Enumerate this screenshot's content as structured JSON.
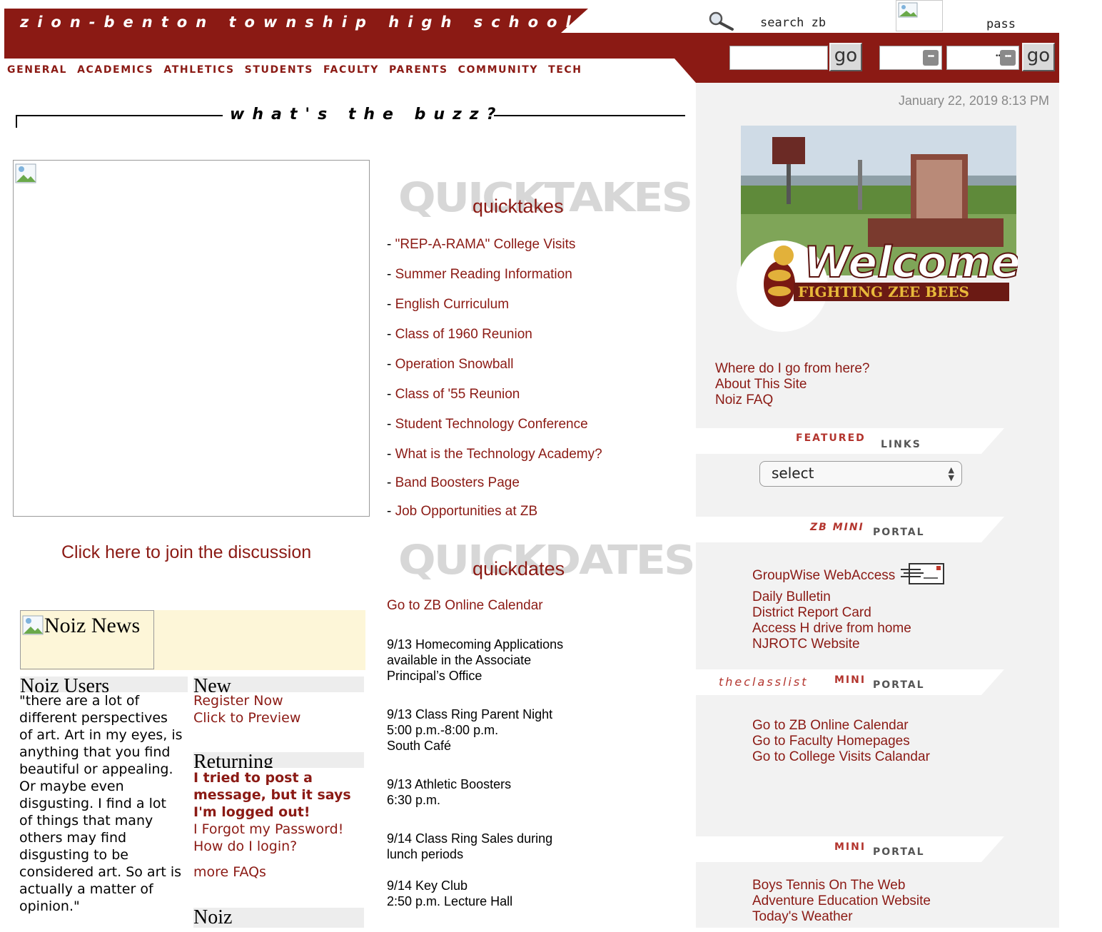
{
  "header": {
    "site_title": "zion-benton township high school",
    "search_label": "search zb",
    "pass_label": "pass",
    "go_label": "go",
    "nav": [
      "GENERAL",
      "ACADEMICS",
      "ATHLETICS",
      "STUDENTS",
      "FACULTY",
      "PARENTS",
      "COMMUNITY",
      "TECH"
    ]
  },
  "buzz": {
    "title": "what's the buzz?",
    "discussion_link": "Click here to join the discussion"
  },
  "quicktakes": {
    "big": "QUICKTAKES",
    "label": "quicktakes",
    "items": [
      "\"REP-A-RAMA\" College Visits",
      "Summer Reading Information",
      "English Curriculum",
      "Class of 1960 Reunion",
      "Operation Snowball",
      "Class of '55 Reunion",
      "Student Technology Conference",
      "What is the Technology Academy?",
      "Band Boosters Page",
      "Job Opportunities at ZB"
    ]
  },
  "quickdates": {
    "big": "QUICKDATES",
    "label": "quickdates",
    "calendar_link": "Go to ZB Online Calendar",
    "events": [
      [
        "9/13 Homecoming Applications",
        "available in the Associate",
        "Principal’s Office"
      ],
      [
        "9/13 Class Ring Parent Night",
        "5:00 p.m.-8:00 p.m.",
        "South Café"
      ],
      [
        "9/13 Athletic Boosters",
        "6:30 p.m."
      ],
      [
        "9/14 Class Ring Sales during",
        "lunch periods"
      ],
      [
        "9/14 Key Club",
        "2:50 p.m. Lecture Hall"
      ]
    ]
  },
  "noiz": {
    "news_alt": "Noiz News",
    "users_head": "Noiz Users",
    "new_head": "New",
    "returning_head": "Returning",
    "faq_head": "Noiz",
    "quote": "\"there are a lot of different perspectives of art. Art in my eyes, is anything that you find beautiful or appealing. Or maybe even disgusting. I find a lot of things that many others may find disgusting to be considered art. So art is actually a matter of opinion.\"",
    "new_links": [
      "Register Now",
      "Click to Preview"
    ],
    "returning_bold": "I tried to post a message, but it says I'm logged out!",
    "returning_links": [
      "I Forgot my Password!",
      "How do I login?"
    ],
    "more_faqs": "more FAQs"
  },
  "sidebar": {
    "date": "January 22, 2019 8:13 PM",
    "welcome_text": "Welcome",
    "welcome_sub": "FIGHTING ZEE BEES",
    "help_links": [
      "Where do I go from here?",
      "About This Site",
      "Noiz FAQ"
    ],
    "featured": {
      "a": "FEATURED",
      "b": "LINKS",
      "select": "select"
    },
    "zb_portal": {
      "a": "ZB MINI",
      "b": "PORTAL",
      "links": [
        "GroupWise WebAccess",
        "Daily Bulletin",
        "District Report Card",
        "Access H drive from home",
        "NJROTC Website"
      ]
    },
    "classlist_portal": {
      "a": "theclasslist",
      "m": "MINI",
      "b": "PORTAL",
      "links": [
        "Go to ZB Online Calendar",
        "Go to Faculty Homepages",
        "Go to College Visits Calandar"
      ]
    },
    "mini_portal": {
      "a": "MINI",
      "b": "PORTAL",
      "links": [
        "Boys Tennis On The Web",
        "Adventure Education Website",
        "Today's Weather"
      ]
    }
  },
  "colors": {
    "brand_red": "#8b1a14",
    "sidebar_gray": "#f2f2f2",
    "noiz_yellow": "#fdf6d8"
  }
}
